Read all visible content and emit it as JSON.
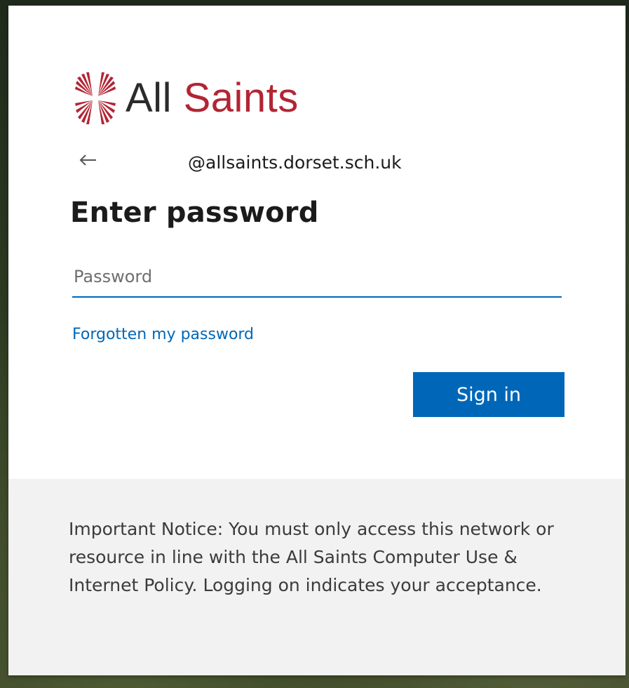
{
  "brand": {
    "name_part1": "All",
    "name_part2": "Saints",
    "logo_icon": "sunburst-cross-logo",
    "color_dark": "#2b2b2b",
    "color_red": "#b22534"
  },
  "identity": {
    "back_icon": "arrow-left-icon",
    "email": "@allsaints.dorset.sch.uk"
  },
  "form": {
    "title": "Enter password",
    "password_placeholder": "Password",
    "password_value": "",
    "forgot_link": "Forgotten my password",
    "sign_in_label": "Sign in",
    "accent_color": "#0067b8"
  },
  "notice": {
    "text": "Important Notice: You must only access this network or resource in line with the All Saints Computer Use & Internet Policy. Logging on indicates your acceptance."
  }
}
